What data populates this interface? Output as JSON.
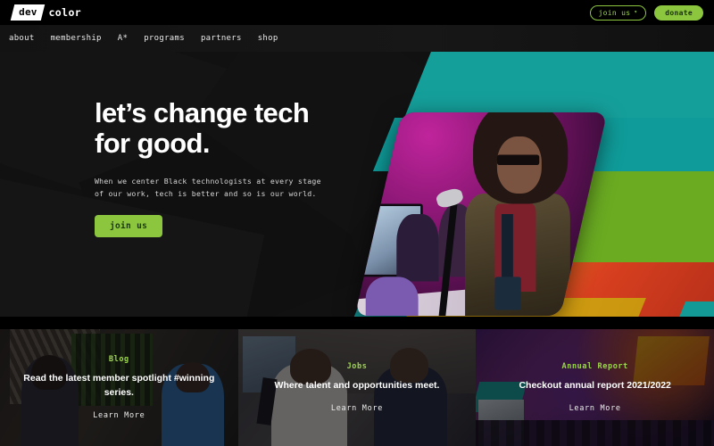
{
  "topbar": {
    "logo": {
      "badge_text": "dev",
      "word": "color",
      "icon": "devcolor-logo"
    },
    "join_button": {
      "label": "join us",
      "caret": "▾",
      "icon": "chevron-down-icon"
    },
    "donate_button": {
      "label": "donate"
    }
  },
  "nav": {
    "items": [
      {
        "label": "about"
      },
      {
        "label": "membership"
      },
      {
        "label": "A*"
      },
      {
        "label": "programs"
      },
      {
        "label": "partners"
      },
      {
        "label": "shop"
      }
    ]
  },
  "hero": {
    "title_line1": "let’s change tech",
    "title_line2": "for good.",
    "subtitle": "When we center Black technologists at every stage of our work, tech is better and so is our world.",
    "cta_label": "join us",
    "photo_alt": "speaker-at-microphone"
  },
  "cards": [
    {
      "kicker": "Blog",
      "title": "Read the latest member spotlight #winning series.",
      "link_label": "Learn More",
      "image_alt": "two-people-laughing-on-stage"
    },
    {
      "kicker": "Jobs",
      "title": "Where talent and opportunities meet.",
      "link_label": "Learn More",
      "image_alt": "two-men-at-conference"
    },
    {
      "kicker": "Annual Report",
      "title": "Checkout annual report 2021/2022",
      "link_label": "Learn More",
      "image_alt": "colorful-event-collage"
    }
  ],
  "colors": {
    "accent_green": "#8CC63F",
    "kicker_green": "#9ED44F",
    "teal": "#139a97",
    "olive": "#6aab22",
    "warm_orange": "#d8401f",
    "background_dark": "#0c0c0c"
  }
}
